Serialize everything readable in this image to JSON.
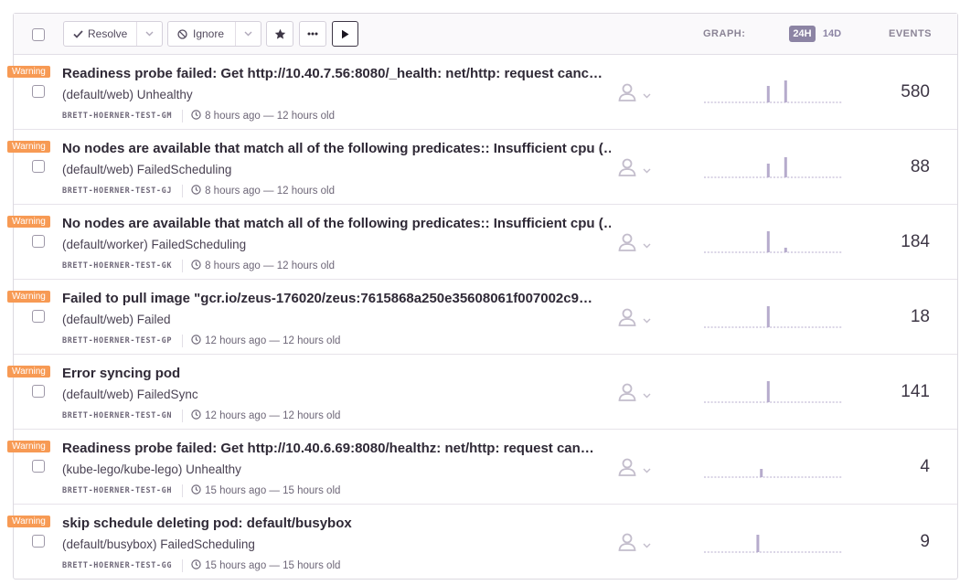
{
  "toolbar": {
    "resolve_label": "Resolve",
    "ignore_label": "Ignore",
    "graph_label": "GRAPH:",
    "period_24h": "24H",
    "period_14d": "14D",
    "events_label": "EVENTS",
    "active_period": "24H"
  },
  "colors": {
    "level_warning": "#f79a54",
    "accent": "#8c84a4",
    "spark_bar": "#b6abcc"
  },
  "issues": [
    {
      "level": "Warning",
      "title": "Readiness probe failed: Get http://10.40.7.56:8080/_health: net/http: request canc…",
      "culprit": "(default/web) Unhealthy",
      "project": "BRETT-HOERNER-TEST-GM",
      "time": "8 hours ago — 12 hours old",
      "events": "580",
      "spark": [
        0,
        0,
        0,
        0,
        0,
        0,
        0,
        0,
        0,
        0,
        0,
        0,
        0,
        0,
        0,
        0,
        0,
        0,
        18,
        0,
        0,
        0,
        0,
        24,
        0,
        0,
        0,
        0,
        0,
        0,
        0,
        0,
        0,
        0,
        0,
        0,
        0,
        0,
        0,
        0
      ]
    },
    {
      "level": "Warning",
      "title": "No nodes are available that match all of the following predicates:: Insufficient cpu (…",
      "culprit": "(default/web) FailedScheduling",
      "project": "BRETT-HOERNER-TEST-GJ",
      "time": "8 hours ago — 12 hours old",
      "events": "88",
      "spark": [
        0,
        0,
        0,
        0,
        0,
        0,
        0,
        0,
        0,
        0,
        0,
        0,
        0,
        0,
        0,
        0,
        0,
        0,
        15,
        0,
        0,
        0,
        0,
        22,
        0,
        0,
        0,
        0,
        0,
        0,
        0,
        0,
        0,
        0,
        0,
        0,
        0,
        0,
        0,
        0
      ]
    },
    {
      "level": "Warning",
      "title": "No nodes are available that match all of the following predicates:: Insufficient cpu (…",
      "culprit": "(default/worker) FailedScheduling",
      "project": "BRETT-HOERNER-TEST-GK",
      "time": "8 hours ago — 12 hours old",
      "events": "184",
      "spark": [
        0,
        0,
        0,
        0,
        0,
        0,
        0,
        0,
        0,
        0,
        0,
        0,
        0,
        0,
        0,
        0,
        0,
        0,
        23,
        0,
        0,
        0,
        0,
        5,
        0,
        0,
        0,
        0,
        0,
        0,
        0,
        0,
        0,
        0,
        0,
        0,
        0,
        0,
        0,
        0
      ]
    },
    {
      "level": "Warning",
      "title": "Failed to pull image \"gcr.io/zeus-176020/zeus:7615868a250e35608061f007002c9…",
      "culprit": "(default/web) Failed",
      "project": "BRETT-HOERNER-TEST-GP",
      "time": "12 hours ago — 12 hours old",
      "events": "18",
      "spark": [
        0,
        0,
        0,
        0,
        0,
        0,
        0,
        0,
        0,
        0,
        0,
        0,
        0,
        0,
        0,
        0,
        0,
        0,
        23,
        0,
        0,
        0,
        0,
        0,
        0,
        0,
        0,
        0,
        0,
        0,
        0,
        0,
        0,
        0,
        0,
        0,
        0,
        0,
        0,
        0
      ]
    },
    {
      "level": "Warning",
      "title": "Error syncing pod",
      "culprit": "(default/web) FailedSync",
      "project": "BRETT-HOERNER-TEST-GN",
      "time": "12 hours ago — 12 hours old",
      "events": "141",
      "spark": [
        0,
        0,
        0,
        0,
        0,
        0,
        0,
        0,
        0,
        0,
        0,
        0,
        0,
        0,
        0,
        0,
        0,
        0,
        23,
        0,
        0,
        0,
        0,
        0,
        0,
        0,
        0,
        0,
        0,
        0,
        0,
        0,
        0,
        0,
        0,
        0,
        0,
        0,
        0,
        0
      ]
    },
    {
      "level": "Warning",
      "title": "Readiness probe failed: Get http://10.40.6.69:8080/healthz: net/http: request can…",
      "culprit": "(kube-lego/kube-lego) Unhealthy",
      "project": "BRETT-HOERNER-TEST-GH",
      "time": "15 hours ago — 15 hours old",
      "events": "4",
      "spark": [
        0,
        0,
        0,
        0,
        0,
        0,
        0,
        0,
        0,
        0,
        0,
        0,
        0,
        0,
        0,
        0,
        9,
        0,
        0,
        0,
        0,
        0,
        0,
        0,
        0,
        0,
        0,
        0,
        0,
        0,
        0,
        0,
        0,
        0,
        0,
        0,
        0,
        0,
        0,
        0
      ]
    },
    {
      "level": "Warning",
      "title": "skip schedule deleting pod: default/busybox",
      "culprit": "(default/busybox) FailedScheduling",
      "project": "BRETT-HOERNER-TEST-GG",
      "time": "15 hours ago — 15 hours old",
      "events": "9",
      "spark": [
        0,
        0,
        0,
        0,
        0,
        0,
        0,
        0,
        0,
        0,
        0,
        0,
        0,
        0,
        0,
        19,
        0,
        0,
        0,
        0,
        0,
        0,
        0,
        0,
        0,
        0,
        0,
        0,
        0,
        0,
        0,
        0,
        0,
        0,
        0,
        0,
        0,
        0,
        0,
        0
      ]
    }
  ]
}
